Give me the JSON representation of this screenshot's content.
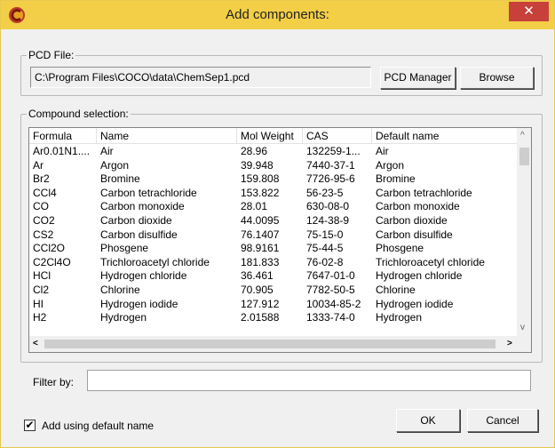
{
  "window": {
    "title": "Add components:",
    "close_glyph": "✕",
    "icon": "coco-logo-icon"
  },
  "pcd": {
    "group_label": "PCD File:",
    "path": "C:\\Program Files\\COCO\\data\\ChemSep1.pcd",
    "manager_label": "PCD Manager",
    "browse_label": "Browse"
  },
  "compounds": {
    "group_label": "Compound selection:",
    "headers": [
      "Formula",
      "Name",
      "Mol Weight",
      "CAS",
      "Default name"
    ],
    "rows": [
      [
        "Ar0.01N1....",
        "Air",
        "28.96",
        "132259-1...",
        "Air"
      ],
      [
        "Ar",
        "Argon",
        "39.948",
        "7440-37-1",
        "Argon"
      ],
      [
        "Br2",
        "Bromine",
        "159.808",
        "7726-95-6",
        "Bromine"
      ],
      [
        "CCl4",
        "Carbon tetrachloride",
        "153.822",
        "56-23-5",
        "Carbon tetrachloride"
      ],
      [
        "CO",
        "Carbon monoxide",
        "28.01",
        "630-08-0",
        "Carbon monoxide"
      ],
      [
        "CO2",
        "Carbon dioxide",
        "44.0095",
        "124-38-9",
        "Carbon dioxide"
      ],
      [
        "CS2",
        "Carbon disulfide",
        "76.1407",
        "75-15-0",
        "Carbon disulfide"
      ],
      [
        "CCl2O",
        "Phosgene",
        "98.9161",
        "75-44-5",
        "Phosgene"
      ],
      [
        "C2Cl4O",
        "Trichloroacetyl chloride",
        "181.833",
        "76-02-8",
        "Trichloroacetyl chloride"
      ],
      [
        "HCl",
        "Hydrogen chloride",
        "36.461",
        "7647-01-0",
        "Hydrogen chloride"
      ],
      [
        "Cl2",
        "Chlorine",
        "70.905",
        "7782-50-5",
        "Chlorine"
      ],
      [
        "HI",
        "Hydrogen iodide",
        "127.912",
        "10034-85-2",
        "Hydrogen iodide"
      ],
      [
        "H2",
        "Hydrogen",
        "2.01588",
        "1333-74-0",
        "Hydrogen"
      ]
    ]
  },
  "scroll": {
    "up": "^",
    "down": "v",
    "left": "<",
    "right": ">"
  },
  "filter": {
    "label": "Filter by:",
    "value": ""
  },
  "options": {
    "add_default_label": "Add using default name",
    "add_default_checked": true,
    "check_glyph": "✔"
  },
  "actions": {
    "ok_label": "OK",
    "cancel_label": "Cancel"
  },
  "colors": {
    "titlebar": "#f2cf46",
    "close": "#c7403a"
  }
}
